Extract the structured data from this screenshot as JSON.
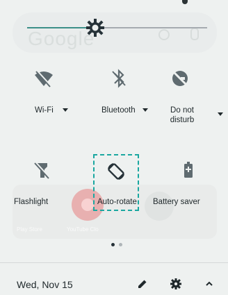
{
  "background": {
    "search_ghost_text": "Google",
    "faded_texts": [
      "Play Store",
      "YouTube Clo"
    ]
  },
  "brightness": {
    "level_fraction": 0.37,
    "accent_color": "#3c8f88"
  },
  "tiles": [
    {
      "label": "Wi-Fi",
      "icon": "wifi-off-icon",
      "has_dropdown": true,
      "active": false
    },
    {
      "label": "Bluetooth",
      "icon": "bluetooth-off-icon",
      "has_dropdown": true,
      "active": false
    },
    {
      "label_line1": "Do not",
      "label_line2": "disturb",
      "icon": "do-not-disturb-off-icon",
      "has_dropdown": true,
      "active": false
    },
    {
      "label": "Flashlight",
      "icon": "flashlight-off-icon",
      "active": false
    },
    {
      "label": "Auto-rotate",
      "icon": "auto-rotate-icon",
      "active": true
    },
    {
      "label": "Battery saver",
      "icon": "battery-saver-icon",
      "active": false
    }
  ],
  "pagination": {
    "current": 1,
    "total": 2
  },
  "footer": {
    "date": "Wed, Nov 15",
    "edit_icon": "pencil-icon",
    "settings_icon": "gear-icon",
    "collapse_icon": "chevron-up-icon"
  }
}
